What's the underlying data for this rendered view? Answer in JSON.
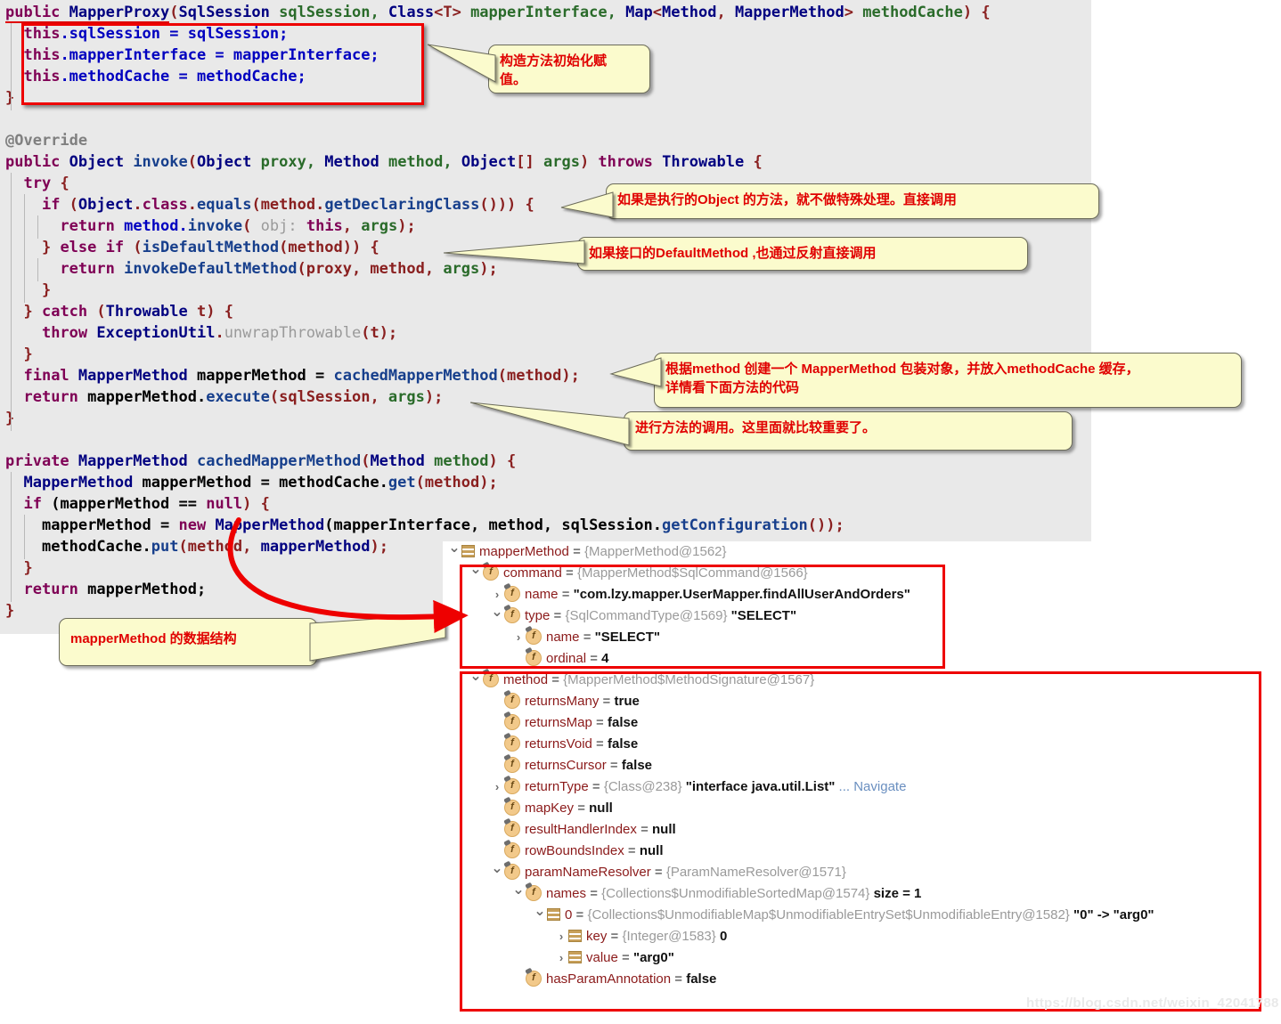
{
  "editor": {
    "lines": [
      [
        {
          "t": "public ",
          "c": "kw err"
        },
        {
          "t": "MapperProxy",
          "c": "typ err"
        },
        {
          "t": "(",
          "c": "pun"
        },
        {
          "t": "SqlSession",
          "c": "typ"
        },
        {
          "t": " sqlSession, ",
          "c": "par"
        },
        {
          "t": "Class",
          "c": "typ"
        },
        {
          "t": "<T> ",
          "c": "pun"
        },
        {
          "t": "mapperInterface, ",
          "c": "par"
        },
        {
          "t": "Map",
          "c": "typ"
        },
        {
          "t": "<",
          "c": "pun"
        },
        {
          "t": "Method",
          "c": "typ"
        },
        {
          "t": ", ",
          "c": "pun"
        },
        {
          "t": "MapperMethod",
          "c": "typ"
        },
        {
          "t": "> ",
          "c": "pun"
        },
        {
          "t": "methodCache",
          "c": "par"
        },
        {
          "t": ") {",
          "c": "pun"
        }
      ],
      [
        {
          "t": "  ",
          "c": "id"
        },
        {
          "t": "this",
          "c": "kw"
        },
        {
          "t": ".sqlSession = sqlSession;",
          "c": "fld"
        }
      ],
      [
        {
          "t": "  ",
          "c": "id"
        },
        {
          "t": "this",
          "c": "kw"
        },
        {
          "t": ".mapperInterface = mapperInterface;",
          "c": "fld"
        }
      ],
      [
        {
          "t": "  ",
          "c": "id"
        },
        {
          "t": "this",
          "c": "kw"
        },
        {
          "t": ".methodCache = methodCache;",
          "c": "fld"
        }
      ],
      [
        {
          "t": "}",
          "c": "pun"
        }
      ],
      [
        {
          "t": "",
          "c": "id"
        }
      ],
      [
        {
          "t": "@Override",
          "c": "ann"
        }
      ],
      [
        {
          "t": "public ",
          "c": "kw"
        },
        {
          "t": "Object ",
          "c": "typ"
        },
        {
          "t": "invoke",
          "c": "mth"
        },
        {
          "t": "(",
          "c": "pun"
        },
        {
          "t": "Object",
          "c": "typ"
        },
        {
          "t": " proxy, ",
          "c": "par"
        },
        {
          "t": "Method",
          "c": "typ"
        },
        {
          "t": " method, ",
          "c": "par"
        },
        {
          "t": "Object",
          "c": "typ"
        },
        {
          "t": "[] ",
          "c": "pun"
        },
        {
          "t": "args",
          "c": "par"
        },
        {
          "t": ") ",
          "c": "pun"
        },
        {
          "t": "throws ",
          "c": "kw"
        },
        {
          "t": "Throwable",
          "c": "typ"
        },
        {
          "t": " {",
          "c": "pun"
        }
      ],
      [
        {
          "t": "  ",
          "c": "id"
        },
        {
          "t": "try",
          "c": "kw"
        },
        {
          "t": " {",
          "c": "pun"
        }
      ],
      [
        {
          "t": "    ",
          "c": "id"
        },
        {
          "t": "if ",
          "c": "kw"
        },
        {
          "t": "(",
          "c": "pun"
        },
        {
          "t": "Object",
          "c": "typ"
        },
        {
          "t": ".",
          "c": "pun"
        },
        {
          "t": "class",
          "c": "kw"
        },
        {
          "t": ".",
          "c": "pun"
        },
        {
          "t": "equals",
          "c": "mth"
        },
        {
          "t": "(method.",
          "c": "pun"
        },
        {
          "t": "getDeclaringClass",
          "c": "mth"
        },
        {
          "t": "())) {",
          "c": "pun"
        }
      ],
      [
        {
          "t": "      ",
          "c": "id"
        },
        {
          "t": "return ",
          "c": "kw"
        },
        {
          "t": "method.",
          "c": "fld"
        },
        {
          "t": "invoke",
          "c": "mth"
        },
        {
          "t": "( ",
          "c": "pun"
        },
        {
          "t": "obj:",
          "c": "hint"
        },
        {
          "t": " ",
          "c": "id"
        },
        {
          "t": "this",
          "c": "kw"
        },
        {
          "t": ", ",
          "c": "pun"
        },
        {
          "t": "args",
          "c": "par"
        },
        {
          "t": ");",
          "c": "pun"
        }
      ],
      [
        {
          "t": "    ",
          "c": "id"
        },
        {
          "t": "} ",
          "c": "pun"
        },
        {
          "t": "else if ",
          "c": "kw"
        },
        {
          "t": "(",
          "c": "pun"
        },
        {
          "t": "isDefaultMethod",
          "c": "mth"
        },
        {
          "t": "(method)) {",
          "c": "pun"
        }
      ],
      [
        {
          "t": "      ",
          "c": "id"
        },
        {
          "t": "return ",
          "c": "kw"
        },
        {
          "t": "invokeDefaultMethod",
          "c": "mth"
        },
        {
          "t": "(proxy, method, ",
          "c": "pun"
        },
        {
          "t": "args",
          "c": "par"
        },
        {
          "t": ");",
          "c": "pun"
        }
      ],
      [
        {
          "t": "    ",
          "c": "id"
        },
        {
          "t": "}",
          "c": "pun"
        }
      ],
      [
        {
          "t": "  ",
          "c": "id"
        },
        {
          "t": "} ",
          "c": "pun"
        },
        {
          "t": "catch ",
          "c": "kw"
        },
        {
          "t": "(",
          "c": "pun"
        },
        {
          "t": "Throwable",
          "c": "typ"
        },
        {
          "t": " t) {",
          "c": "pun"
        }
      ],
      [
        {
          "t": "    ",
          "c": "id"
        },
        {
          "t": "throw ",
          "c": "kw"
        },
        {
          "t": "ExceptionUtil",
          "c": "typ"
        },
        {
          "t": ".",
          "c": "pun"
        },
        {
          "t": "unwrapThrowable",
          "c": "hint"
        },
        {
          "t": "(t);",
          "c": "pun"
        }
      ],
      [
        {
          "t": "  ",
          "c": "id"
        },
        {
          "t": "}",
          "c": "pun"
        }
      ],
      [
        {
          "t": "  ",
          "c": "id"
        },
        {
          "t": "final ",
          "c": "kw"
        },
        {
          "t": "MapperMethod",
          "c": "typ"
        },
        {
          "t": " mapperMethod = ",
          "c": "id"
        },
        {
          "t": "cachedMapperMethod",
          "c": "mth"
        },
        {
          "t": "(method);",
          "c": "pun"
        }
      ],
      [
        {
          "t": "  ",
          "c": "id"
        },
        {
          "t": "return ",
          "c": "kw"
        },
        {
          "t": "mapperMethod.",
          "c": "id"
        },
        {
          "t": "execute",
          "c": "mth"
        },
        {
          "t": "(sqlSession, ",
          "c": "pun"
        },
        {
          "t": "args",
          "c": "par"
        },
        {
          "t": ");",
          "c": "pun"
        }
      ],
      [
        {
          "t": "}",
          "c": "pun"
        }
      ],
      [
        {
          "t": "",
          "c": "id"
        }
      ],
      [
        {
          "t": "private ",
          "c": "kw"
        },
        {
          "t": "MapperMethod ",
          "c": "typ"
        },
        {
          "t": "cachedMapperMethod",
          "c": "mth"
        },
        {
          "t": "(",
          "c": "pun"
        },
        {
          "t": "Method",
          "c": "typ"
        },
        {
          "t": " method",
          "c": "par"
        },
        {
          "t": ") {",
          "c": "pun"
        }
      ],
      [
        {
          "t": "  ",
          "c": "id"
        },
        {
          "t": "MapperMethod",
          "c": "typ"
        },
        {
          "t": " mapperMethod = methodCache.",
          "c": "id"
        },
        {
          "t": "get",
          "c": "mth"
        },
        {
          "t": "(method);",
          "c": "pun"
        }
      ],
      [
        {
          "t": "  ",
          "c": "id"
        },
        {
          "t": "if ",
          "c": "kw"
        },
        {
          "t": "(mapperMethod == ",
          "c": "id"
        },
        {
          "t": "null",
          "c": "kw"
        },
        {
          "t": ") {",
          "c": "pun"
        }
      ],
      [
        {
          "t": "    ",
          "c": "id"
        },
        {
          "t": "mapperMethod = ",
          "c": "id"
        },
        {
          "t": "new ",
          "c": "kw"
        },
        {
          "t": "MapperMethod",
          "c": "typ"
        },
        {
          "t": "(mapperInterface, method, sqlSession.",
          "c": "id"
        },
        {
          "t": "getConfiguration",
          "c": "mth"
        },
        {
          "t": "());",
          "c": "pun"
        }
      ],
      [
        {
          "t": "    ",
          "c": "id"
        },
        {
          "t": "methodCache.",
          "c": "id"
        },
        {
          "t": "put",
          "c": "mth"
        },
        {
          "t": "(method, ",
          "c": "pun"
        },
        {
          "t": "mapperMethod",
          "c": "typ"
        },
        {
          "t": ");",
          "c": "pun"
        }
      ],
      [
        {
          "t": "  ",
          "c": "id"
        },
        {
          "t": "}",
          "c": "pun"
        }
      ],
      [
        {
          "t": "  ",
          "c": "id"
        },
        {
          "t": "return ",
          "c": "kw"
        },
        {
          "t": "mapperMethod;",
          "c": "id"
        }
      ],
      [
        {
          "t": "}",
          "c": "pun"
        }
      ]
    ]
  },
  "callouts": {
    "c1": "构造方法初始化赋\n值。",
    "c2": "如果是执行的Object 的方法，就不做特殊处理。直接调用",
    "c3": "如果接口的DefaultMethod ,也通过反射直接调用",
    "c4": "根据method 创建一个 MapperMethod 包装对象，并放入methodCache 缓存，\n详情看下面方法的代码",
    "c5": "进行方法的调用。这里面就比较重要了。",
    "c6": "mapperMethod 的数据结构"
  },
  "debugger": {
    "rows": [
      {
        "indent": 0,
        "chev": "v",
        "icon": "list",
        "name": "mapperMethod",
        "eq": " = ",
        "ref": "{MapperMethod@1562}",
        "val": "",
        "tail": ""
      },
      {
        "indent": 1,
        "chev": "v",
        "icon": "f",
        "name": "command",
        "eq": " = ",
        "ref": "{MapperMethod$SqlCommand@1566}",
        "val": "",
        "tail": ""
      },
      {
        "indent": 2,
        "chev": ">",
        "icon": "f",
        "name": "name",
        "eq": " = ",
        "ref": "",
        "val": "\"com.lzy.mapper.UserMapper.findAllUserAndOrders\"",
        "tail": ""
      },
      {
        "indent": 2,
        "chev": "v",
        "icon": "f",
        "name": "type",
        "eq": " = ",
        "ref": "{SqlCommandType@1569}",
        "val": "\"SELECT\"",
        "tail": ""
      },
      {
        "indent": 3,
        "chev": ">",
        "icon": "f",
        "name": "name",
        "eq": " = ",
        "ref": "",
        "val": "\"SELECT\"",
        "tail": ""
      },
      {
        "indent": 3,
        "chev": "",
        "icon": "f",
        "name": "ordinal",
        "eq": " = ",
        "ref": "",
        "val": "4",
        "tail": ""
      },
      {
        "indent": 1,
        "chev": "v",
        "icon": "f",
        "name": "method",
        "eq": " = ",
        "ref": "{MapperMethod$MethodSignature@1567}",
        "val": "",
        "tail": ""
      },
      {
        "indent": 2,
        "chev": "",
        "icon": "f",
        "name": "returnsMany",
        "eq": " = ",
        "ref": "",
        "val": "true",
        "tail": ""
      },
      {
        "indent": 2,
        "chev": "",
        "icon": "f",
        "name": "returnsMap",
        "eq": " = ",
        "ref": "",
        "val": "false",
        "tail": ""
      },
      {
        "indent": 2,
        "chev": "",
        "icon": "f",
        "name": "returnsVoid",
        "eq": " = ",
        "ref": "",
        "val": "false",
        "tail": ""
      },
      {
        "indent": 2,
        "chev": "",
        "icon": "f",
        "name": "returnsCursor",
        "eq": " = ",
        "ref": "",
        "val": "false",
        "tail": ""
      },
      {
        "indent": 2,
        "chev": ">",
        "icon": "f",
        "name": "returnType",
        "eq": " = ",
        "ref": "{Class@238}",
        "val": "\"interface java.util.List\"",
        "tail": "... Navigate"
      },
      {
        "indent": 2,
        "chev": "",
        "icon": "f",
        "name": "mapKey",
        "eq": " = ",
        "ref": "",
        "val": "null",
        "tail": ""
      },
      {
        "indent": 2,
        "chev": "",
        "icon": "f",
        "name": "resultHandlerIndex",
        "eq": " = ",
        "ref": "",
        "val": "null",
        "tail": ""
      },
      {
        "indent": 2,
        "chev": "",
        "icon": "f",
        "name": "rowBoundsIndex",
        "eq": " = ",
        "ref": "",
        "val": "null",
        "tail": ""
      },
      {
        "indent": 2,
        "chev": "v",
        "icon": "f",
        "name": "paramNameResolver",
        "eq": " = ",
        "ref": "{ParamNameResolver@1571}",
        "val": "",
        "tail": ""
      },
      {
        "indent": 3,
        "chev": "v",
        "icon": "f",
        "name": "names",
        "eq": " = ",
        "ref": "{Collections$UnmodifiableSortedMap@1574}",
        "val": "size = 1",
        "tail": ""
      },
      {
        "indent": 4,
        "chev": "v",
        "icon": "list",
        "name": "0",
        "eq": " = ",
        "ref": "{Collections$UnmodifiableMap$UnmodifiableEntrySet$UnmodifiableEntry@1582}",
        "val": "\"0\" -> \"arg0\"",
        "tail": ""
      },
      {
        "indent": 5,
        "chev": ">",
        "icon": "list",
        "name": "key",
        "eq": " = ",
        "ref": "{Integer@1583}",
        "val": "0",
        "tail": ""
      },
      {
        "indent": 5,
        "chev": ">",
        "icon": "list",
        "name": "value",
        "eq": " = ",
        "ref": "",
        "val": "\"arg0\"",
        "tail": ""
      },
      {
        "indent": 3,
        "chev": "",
        "icon": "f",
        "name": "hasParamAnnotation",
        "eq": " = ",
        "ref": "",
        "val": "false",
        "tail": ""
      }
    ]
  },
  "watermark": "https://blog.csdn.net/weixin_42041788",
  "colors": {
    "editor_bg": "#e9e9e9",
    "callout_bg": "#fbfbcd",
    "callout_text": "#e00000",
    "redbox": "#ee0000",
    "arrow": "#ee0000",
    "keyword": "#7f0055",
    "type": "#000080",
    "panel_bg": "#ffffff"
  }
}
